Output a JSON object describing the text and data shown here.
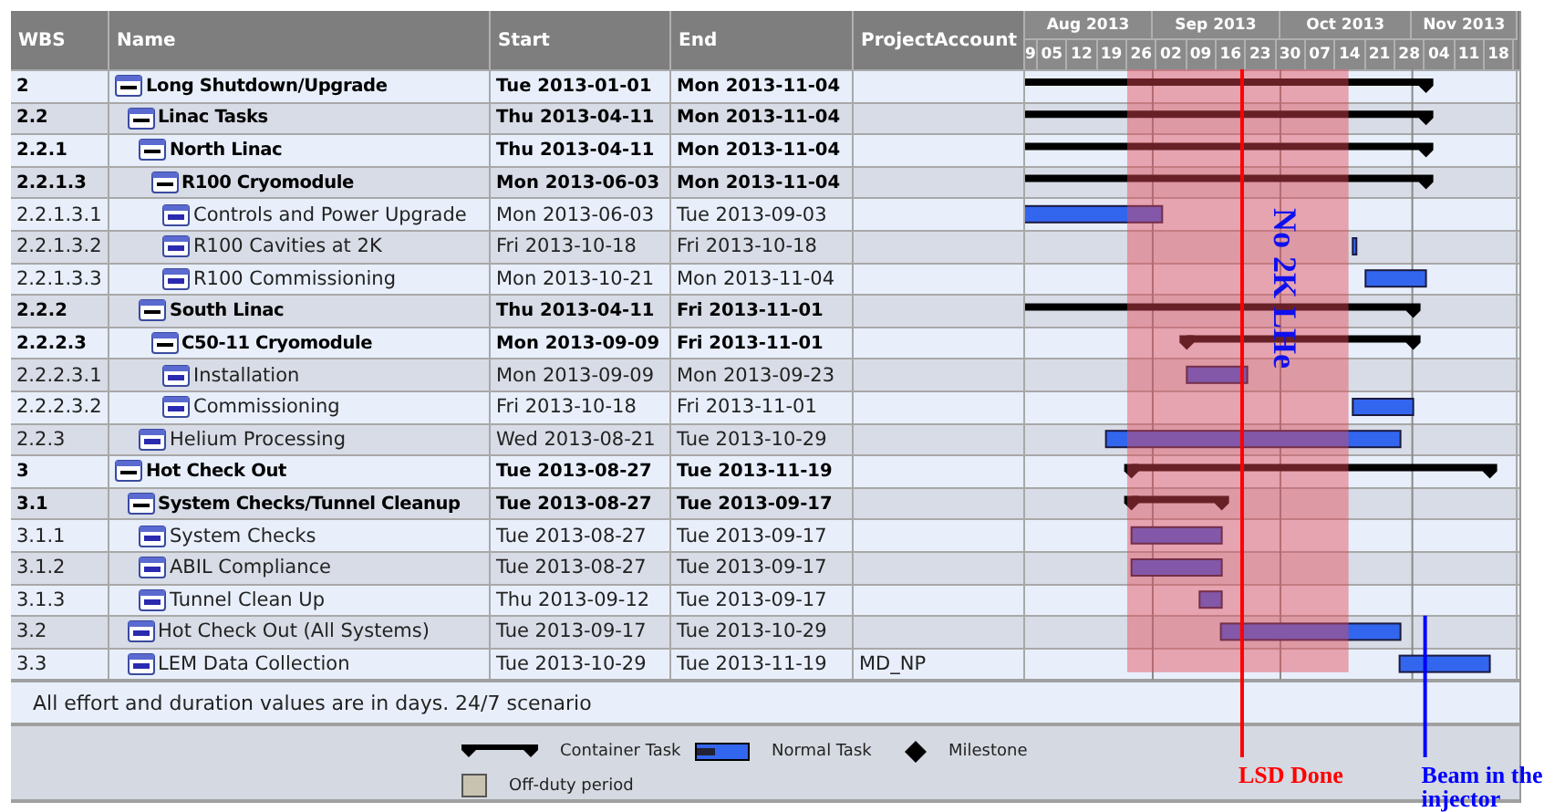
{
  "columns": [
    "WBS",
    "Name",
    "Start",
    "End",
    "ProjectAccount"
  ],
  "months": [
    "Aug 2013",
    "Sep 2013",
    "Oct 2013",
    "Nov 2013"
  ],
  "weeks": [
    "9",
    "05",
    "12",
    "19",
    "26",
    "02",
    "09",
    "16",
    "23",
    "30",
    "07",
    "14",
    "21",
    "28",
    "04",
    "11",
    "18"
  ],
  "rows": [
    {
      "wbs": "2",
      "name": "Long Shutdown/Upgrade",
      "start": "Tue 2013-01-01",
      "end": "Mon 2013-11-04",
      "kind": "container",
      "children": [
        {
          "wbs": "2.2",
          "name": "Linac Tasks",
          "start": "Thu 2013-04-11",
          "end": "Mon 2013-11-04",
          "kind": "container",
          "children": [
            {
              "wbs": "2.2.1",
              "name": "North Linac",
              "start": "Thu 2013-04-11",
              "end": "Mon 2013-11-04",
              "kind": "container",
              "children": [
                {
                  "wbs": "2.2.1.3",
                  "name": "R100 Cryomodule",
                  "start": "Mon 2013-06-03",
                  "end": "Mon 2013-11-04",
                  "kind": "container",
                  "children": [
                    {
                      "wbs": "2.2.1.3.1",
                      "name": "Controls and Power Upgrade",
                      "start": "Mon 2013-06-03",
                      "end": "Tue 2013-09-03",
                      "kind": "task"
                    },
                    {
                      "wbs": "2.2.1.3.2",
                      "name": "R100 Cavities at 2K",
                      "start": "Fri 2013-10-18",
                      "end": "Fri 2013-10-18",
                      "kind": "task"
                    },
                    {
                      "wbs": "2.2.1.3.3",
                      "name": "R100 Commissioning",
                      "start": "Mon 2013-10-21",
                      "end": "Mon 2013-11-04",
                      "kind": "task"
                    }
                  ]
                }
              ]
            },
            {
              "wbs": "2.2.2",
              "name": "South Linac",
              "start": "Thu 2013-04-11",
              "end": "Fri 2013-11-01",
              "kind": "container",
              "children": [
                {
                  "wbs": "2.2.2.3",
                  "name": "C50-11 Cryomodule",
                  "start": "Mon 2013-09-09",
                  "end": "Fri 2013-11-01",
                  "kind": "container",
                  "children": [
                    {
                      "wbs": "2.2.2.3.1",
                      "name": "Installation",
                      "start": "Mon 2013-09-09",
                      "end": "Mon 2013-09-23",
                      "kind": "task"
                    },
                    {
                      "wbs": "2.2.2.3.2",
                      "name": "Commissioning",
                      "start": "Fri 2013-10-18",
                      "end": "Fri 2013-11-01",
                      "kind": "task"
                    }
                  ]
                }
              ]
            },
            {
              "wbs": "2.2.3",
              "name": "Helium Processing",
              "start": "Wed 2013-08-21",
              "end": "Tue 2013-10-29",
              "kind": "task"
            }
          ]
        }
      ]
    },
    {
      "wbs": "3",
      "name": "Hot Check Out",
      "start": "Tue 2013-08-27",
      "end": "Tue 2013-11-19",
      "kind": "container",
      "children": [
        {
          "wbs": "3.1",
          "name": "System Checks/Tunnel Cleanup",
          "start": "Tue 2013-08-27",
          "end": "Tue 2013-09-17",
          "kind": "container",
          "children": [
            {
              "wbs": "3.1.1",
              "name": "System Checks",
              "start": "Tue 2013-08-27",
              "end": "Tue 2013-09-17",
              "kind": "task"
            },
            {
              "wbs": "3.1.2",
              "name": "ABIL Compliance",
              "start": "Tue 2013-08-27",
              "end": "Tue 2013-09-17",
              "kind": "task"
            },
            {
              "wbs": "3.1.3",
              "name": "Tunnel Clean Up",
              "start": "Thu 2013-09-12",
              "end": "Tue 2013-09-17",
              "kind": "task"
            }
          ]
        },
        {
          "wbs": "3.2",
          "name": "Hot Check Out (All Systems)",
          "start": "Tue 2013-09-17",
          "end": "Tue 2013-10-29",
          "kind": "task"
        },
        {
          "wbs": "3.3",
          "name": "LEM Data Collection",
          "start": "Tue 2013-10-29",
          "end": "Tue 2013-11-19",
          "kind": "task",
          "account": "MD_NP"
        }
      ]
    }
  ],
  "note": "All effort and duration values are in days. 24/7 scenario",
  "legend": [
    {
      "kind": "container",
      "label": "Container Task"
    },
    {
      "kind": "task",
      "label": "Normal Task"
    },
    {
      "kind": "milestone",
      "label": "Milestone"
    },
    {
      "kind": "offduty",
      "label": "Off-duty period"
    }
  ],
  "annotations": [
    {
      "kind": "band",
      "label": "No 2K LHe"
    },
    {
      "kind": "line",
      "label": "LSD Done",
      "color": "#ff0000"
    },
    {
      "kind": "line",
      "label": "Beam in the injector",
      "color": "#0000ff"
    }
  ]
}
